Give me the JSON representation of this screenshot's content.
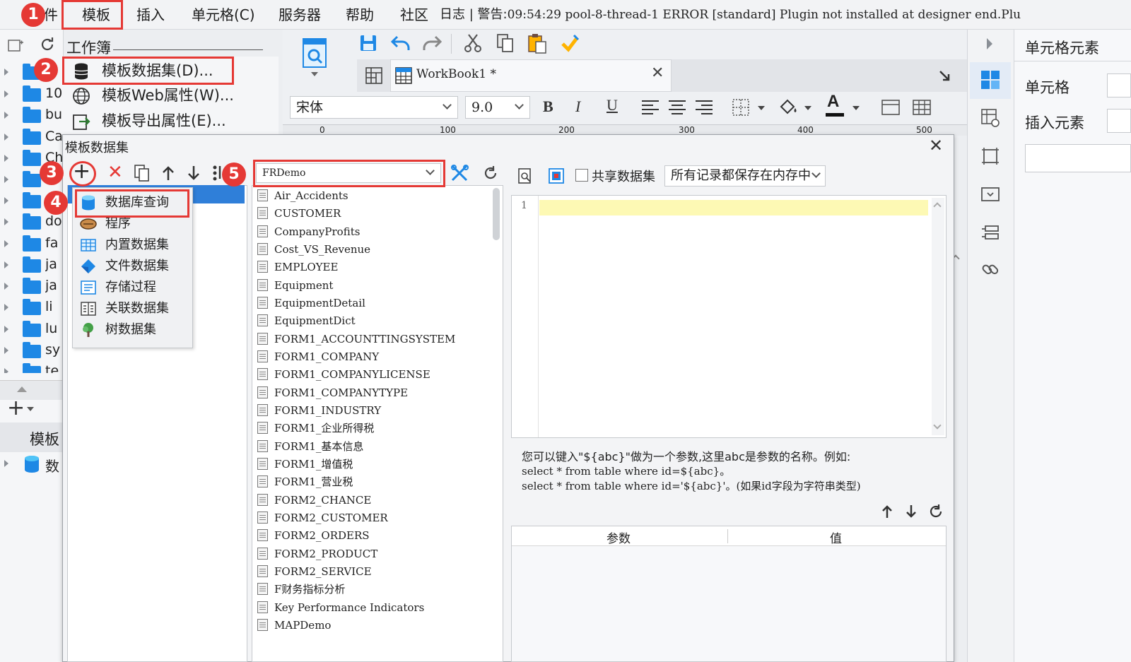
{
  "menubar": {
    "items": [
      {
        "label": "件"
      },
      {
        "label": "模板"
      },
      {
        "label": "插入"
      },
      {
        "label": "单元格(C)"
      },
      {
        "label": "服务器"
      },
      {
        "label": "帮助"
      },
      {
        "label": "社区"
      },
      {
        "label": "日志"
      }
    ],
    "log_prefix": "| 警告:",
    "log_message": "09:54:29 pool-8-thread-1 ERROR [standard] Plugin not installed at designer end.Plu"
  },
  "left_panel": {
    "workbook_label": "工作簿",
    "tree_items": [
      "",
      "10",
      "bu",
      "Ca",
      "Ch",
      "",
      "",
      "do",
      "fa",
      "ja",
      "ja",
      "li",
      "lu",
      "sy",
      "te"
    ],
    "bottom_label": "模板",
    "bottom_item": "数"
  },
  "template_menu": {
    "items": [
      {
        "label": "模板数据集(D)...",
        "icon": "database-icon"
      },
      {
        "label": "模板Web属性(W)...",
        "icon": "globe-icon"
      },
      {
        "label": "模板导出属性(E)...",
        "icon": "export-icon"
      }
    ]
  },
  "toolbar": {
    "tab_label": "WorkBook1 *",
    "font_name": "宋体",
    "font_size": "9.0",
    "ruler_ticks": [
      "0",
      "100",
      "200",
      "300",
      "400",
      "500"
    ]
  },
  "right_panel": {
    "title": "单元格元素",
    "cell_label": "单元格",
    "insert_label": "插入元素"
  },
  "dialog": {
    "title": "模板数据集",
    "new_menu": [
      {
        "label": "数据库查询",
        "icon": "database-query-icon"
      },
      {
        "label": "程序",
        "icon": "program-icon"
      },
      {
        "label": "内置数据集",
        "icon": "builtin-dataset-icon"
      },
      {
        "label": "文件数据集",
        "icon": "file-dataset-icon"
      },
      {
        "label": "存储过程",
        "icon": "stored-procedure-icon"
      },
      {
        "label": "关联数据集",
        "icon": "relation-dataset-icon"
      },
      {
        "label": "树数据集",
        "icon": "tree-dataset-icon"
      }
    ],
    "connection": "FRDemo",
    "tables": [
      "Air_Accidents",
      "CUSTOMER",
      "CompanyProfits",
      "Cost_VS_Revenue",
      "EMPLOYEE",
      "Equipment",
      "EquipmentDetail",
      "EquipmentDict",
      "FORM1_ACCOUNTTINGSYSTEM",
      "FORM1_COMPANY",
      "FORM1_COMPANYLICENSE",
      "FORM1_COMPANYTYPE",
      "FORM1_INDUSTRY",
      "FORM1_企业所得税",
      "FORM1_基本信息",
      "FORM1_增值税",
      "FORM1_营业税",
      "FORM2_CHANCE",
      "FORM2_CUSTOMER",
      "FORM2_ORDERS",
      "FORM2_PRODUCT",
      "FORM2_SERVICE",
      "F财务指标分析",
      "Key Performance Indicators",
      "MAPDemo"
    ],
    "shared_dataset_label": "共享数据集",
    "memory_option": "所有记录都保存在内存中",
    "line_number": "1",
    "hint_lines": [
      "您可以键入\"${abc}\"做为一个参数,这里abc是参数的名称。例如:",
      "select * from table where id=${abc}。",
      "select * from table where id='${abc}'。(如果id字段为字符串类型)"
    ],
    "param_col": "参数",
    "value_col": "值"
  },
  "steps": [
    "1",
    "2",
    "3",
    "4",
    "5"
  ],
  "colors": {
    "highlight": "#e53935",
    "accent": "#1e88e5"
  }
}
